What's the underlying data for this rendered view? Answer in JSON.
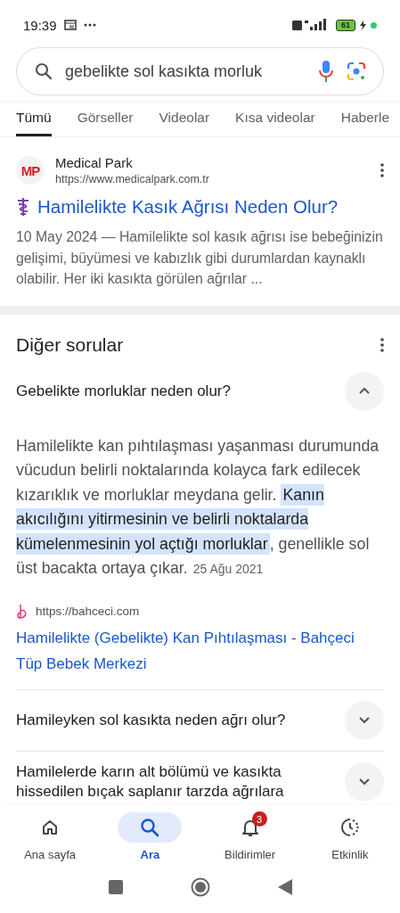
{
  "status_bar": {
    "time": "19:39",
    "battery": "61"
  },
  "search": {
    "value": "gebelikte sol kasıkta morluk"
  },
  "tabs": [
    {
      "label": "Tümü",
      "selected": true
    },
    {
      "label": "Görseller",
      "selected": false
    },
    {
      "label": "Videolar",
      "selected": false
    },
    {
      "label": "Kısa videolar",
      "selected": false
    },
    {
      "label": "Haberle",
      "selected": false
    }
  ],
  "result": {
    "site": "Medical Park",
    "favicon": "MP",
    "url": "https://www.medicalpark.com.tr",
    "title": "Hamilelikte Kasık Ağrısı Neden Olur?",
    "snippet": "10 May 2024 — Hamilelikte sol kasık ağrısı ise bebeğinizin gelişimi, büyümesi ve kabızlık gibi durumlardan kaynaklı olabilir. Her iki kasıkta görülen ağrılar ..."
  },
  "other_questions": {
    "heading": "Diğer sorular",
    "items": [
      {
        "question": "Gebelikte morluklar neden olur?",
        "expanded": true,
        "answer": {
          "before": "Hamilelikte kan pıhtılaşması yaşanması durumunda vücudun belirli noktalarında kolayca fark edilecek kızarıklık ve morluklar meydana gelir.",
          "highlight": "Kanın akıcılığını yitirmesinin ve belirli noktalarda kümelenmesinin yol açtığı morluklar",
          "after": ", genellikle sol üst bacakta ortaya çıkar.",
          "date": "25 Ağu 2021",
          "source_url": "https://bahceci.com",
          "source_title": "Hamilelikte (Gebelikte) Kan Pıhtılaşması - Bahçeci Tüp Bebek Merkezi"
        }
      },
      {
        "question": "Hamileyken sol kasıkta neden ağrı olur?",
        "expanded": false
      },
      {
        "question": "Hamilelerde karın alt bölümü ve kasıkta hissedilen bıçak saplanır tarzda ağrılara",
        "expanded": false
      }
    ]
  },
  "bottom_nav": [
    {
      "label": "Ana sayfa",
      "kind": "home",
      "selected": false
    },
    {
      "label": "Ara",
      "kind": "search",
      "selected": true
    },
    {
      "label": "Bildirimler",
      "kind": "bell",
      "selected": false,
      "badge": "3"
    },
    {
      "label": "Etkinlik",
      "kind": "activity",
      "selected": false
    }
  ]
}
